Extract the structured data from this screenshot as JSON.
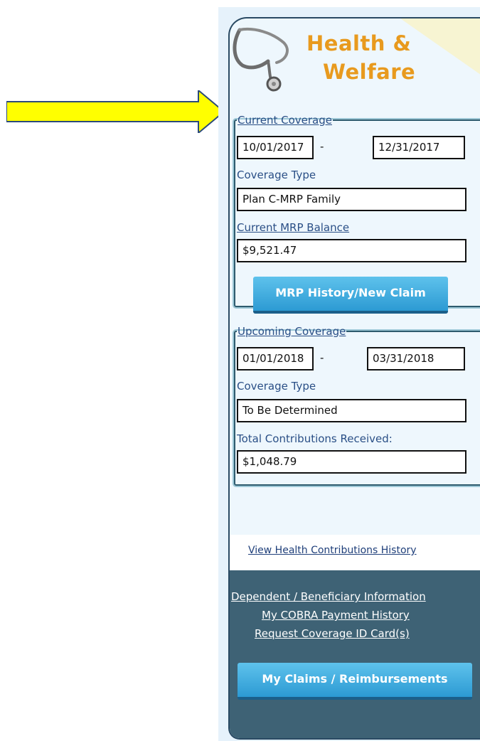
{
  "header": {
    "title_line1": "Health &",
    "title_line2": "Welfare"
  },
  "current": {
    "legend": "Current Coverage",
    "start_date": "10/01/2017",
    "separator": "-",
    "end_date": "12/31/2017",
    "coverage_type_label": "Coverage Type",
    "coverage_type": "Plan C-MRP Family",
    "balance_label": "Current MRP Balance",
    "balance": "$9,521.47",
    "button_label": "MRP History/New Claim"
  },
  "upcoming": {
    "legend": "Upcoming Coverage",
    "start_date": "01/01/2018",
    "separator": "-",
    "end_date": "03/31/2018",
    "coverage_type_label": "Coverage Type",
    "coverage_type": "To Be Determined",
    "contributions_label": "Total Contributions Received:",
    "contributions": "$1,048.79"
  },
  "links": {
    "contributions_history": "View Health Contributions History",
    "dependent_info": "Dependent / Beneficiary Information",
    "cobra_history": "My COBRA Payment History",
    "id_card": "Request Coverage ID Card(s)"
  },
  "claims_button": "My Claims / Reimbursements",
  "colors": {
    "accent_orange": "#e89a1e",
    "arrow_yellow": "#ffff00",
    "button_blue": "#3aa8dd",
    "dark_panel": "#3e6275"
  },
  "icons": {
    "arrow": "arrow-right-icon",
    "logo": "stethoscope-icon"
  }
}
